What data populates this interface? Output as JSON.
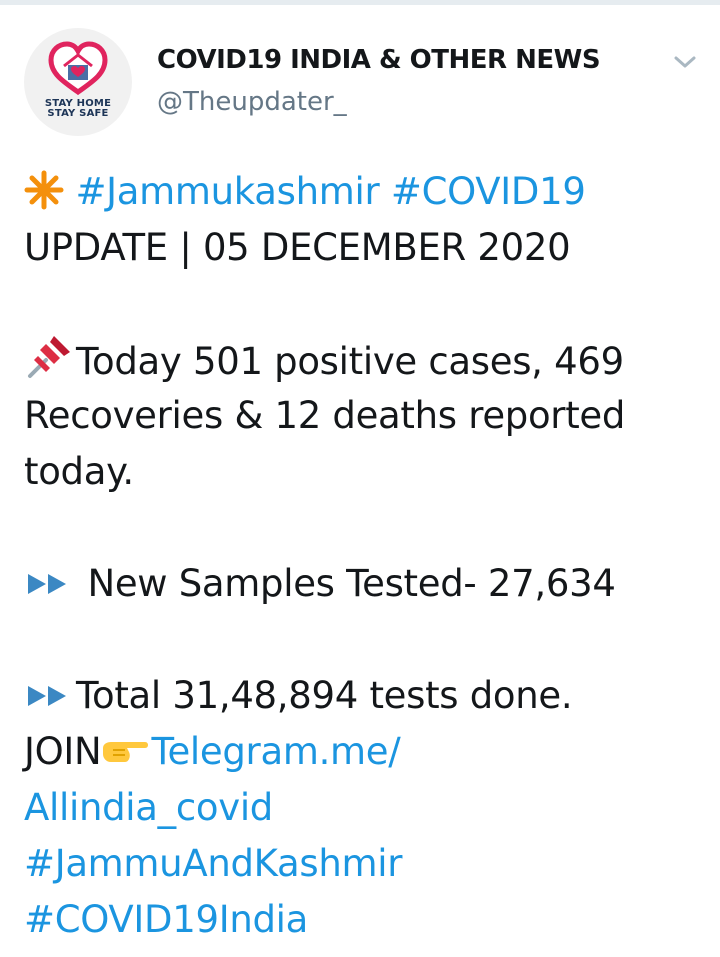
{
  "author": {
    "display_name": "COVID19 INDIA & OTHER NEWS",
    "handle": "@Theupdater_",
    "avatar_text_line1": "STAY HOME",
    "avatar_text_line2": "STAY SAFE"
  },
  "tweet": {
    "hashtag1": "#Jammukashmir",
    "hashtag2": "#COVID19",
    "update_line": "UPDATE | 05 DECEMBER 2020",
    "cases_line1": "Today 501 positive cases, 469",
    "cases_line2": "Recoveries & 12 deaths reported",
    "cases_line3": "today.",
    "samples_line": " New Samples Tested- 27,634",
    "total_line": "Total 31,48,894 tests done.",
    "join_text": "JOIN",
    "telegram_link_part1": "Telegram.me/",
    "telegram_link_part2": "Allindia_covid",
    "hashtag3": "#JammuAndKashmir",
    "hashtag4": "#COVID19India"
  },
  "icons": {
    "asterisk": "eight-spoked-asterisk-icon",
    "pin": "pushpin-icon",
    "fast_forward": "fast-forward-icon",
    "pointing_hand": "backhand-index-pointing-right-icon",
    "caret": "chevron-down-icon",
    "avatar": "heart-house-icon"
  },
  "colors": {
    "link": "#1b95e0",
    "text": "#14171a",
    "muted": "#657786",
    "asterisk": "#f4900c",
    "fast_forward": "#3b88c3",
    "heart_outline": "#e0245e"
  }
}
